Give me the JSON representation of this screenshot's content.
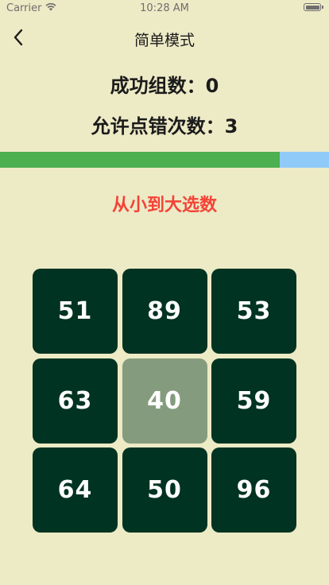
{
  "status_bar": {
    "carrier": "Carrier",
    "time": "10:28 AM"
  },
  "nav": {
    "title": "简单模式"
  },
  "stats": {
    "success_text": "成功组数：0",
    "errors_text": "允许点错次数：3"
  },
  "progress": {
    "fraction": 0.85,
    "fill_color": "#4CAF50",
    "track_color": "#90CAF9"
  },
  "instruction": "从小到大选数",
  "tiles": [
    {
      "value": "51",
      "selected": false
    },
    {
      "value": "89",
      "selected": false
    },
    {
      "value": "53",
      "selected": false
    },
    {
      "value": "63",
      "selected": false
    },
    {
      "value": "40",
      "selected": true
    },
    {
      "value": "59",
      "selected": false
    },
    {
      "value": "64",
      "selected": false
    },
    {
      "value": "50",
      "selected": false
    },
    {
      "value": "96",
      "selected": false
    }
  ],
  "colors": {
    "background": "#EDEAC6",
    "tile": "#003321",
    "tile_selected": "#849C7D",
    "instruction": "#F44336"
  }
}
